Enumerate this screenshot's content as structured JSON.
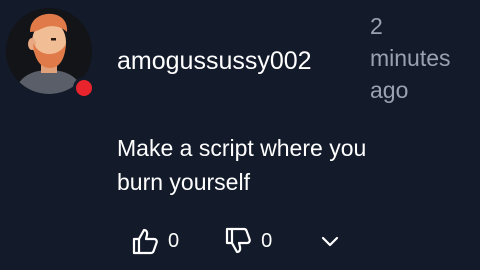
{
  "comment": {
    "author": {
      "username": "amogussussy002",
      "avatar_icon": "bearded-man-avatar",
      "status_color": "#e8242c"
    },
    "timestamp_lines": [
      "2",
      "minutes",
      "ago"
    ],
    "text_lines": [
      "Make a script where you",
      "burn yourself"
    ],
    "reactions": {
      "like_icon": "thumbs-up-icon",
      "like_count": "0",
      "dislike_icon": "thumbs-down-icon",
      "dislike_count": "0",
      "expand_icon": "chevron-down-icon"
    }
  },
  "colors": {
    "background": "#131a2a",
    "text": "#ffffff",
    "muted_text": "#9aa2b1",
    "status_dot": "#e8242c"
  }
}
